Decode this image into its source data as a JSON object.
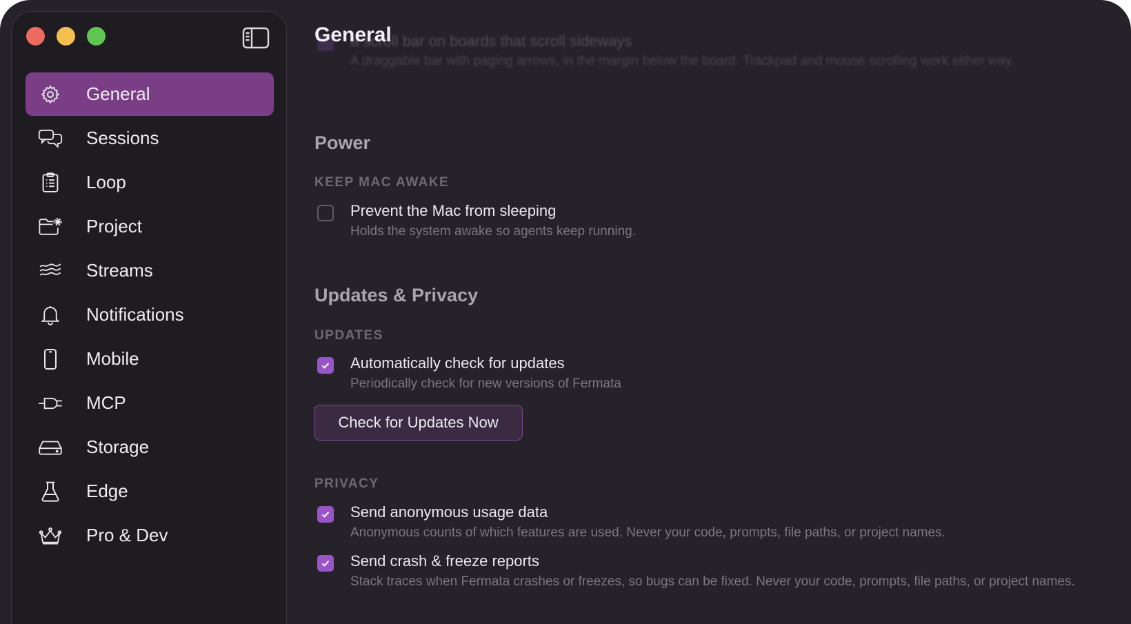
{
  "window": {
    "traffic_lights": [
      "#ed6a5e",
      "#f4bf4f",
      "#61c554"
    ],
    "accent": "#7a3e86"
  },
  "sidebar": {
    "toggle_icon": "sidebar-toggle-icon",
    "items": [
      {
        "label": "General",
        "icon": "gear-icon",
        "active": true
      },
      {
        "label": "Sessions",
        "icon": "chat-bubbles-icon"
      },
      {
        "label": "Loop",
        "icon": "clipboard-list-icon"
      },
      {
        "label": "Project",
        "icon": "folder-gear-icon"
      },
      {
        "label": "Streams",
        "icon": "waves-icon"
      },
      {
        "label": "Notifications",
        "icon": "bell-icon"
      },
      {
        "label": "Mobile",
        "icon": "phone-icon"
      },
      {
        "label": "MCP",
        "icon": "plug-icon"
      },
      {
        "label": "Storage",
        "icon": "drive-icon"
      },
      {
        "label": "Edge",
        "icon": "flask-icon"
      },
      {
        "label": "Pro & Dev",
        "icon": "crown-icon"
      }
    ]
  },
  "main": {
    "title": "General",
    "scrolled_option": {
      "title": "a scroll bar on boards that scroll sideways",
      "desc": "A draggable bar with paging arrows, in the margin below the board. Trackpad and mouse scrolling work either way."
    },
    "power": {
      "title": "Power",
      "group": "KEEP MAC AWAKE",
      "option": {
        "title": "Prevent the Mac from sleeping",
        "desc": "Holds the system awake so agents keep running.",
        "checked": false
      }
    },
    "updates_privacy": {
      "title": "Updates & Privacy",
      "updates_group": "UPDATES",
      "auto_update": {
        "title": "Automatically check for updates",
        "desc": "Periodically check for new versions of Fermata",
        "checked": true
      },
      "check_button": "Check for Updates Now",
      "privacy_group": "PRIVACY",
      "usage": {
        "title": "Send anonymous usage data",
        "desc": "Anonymous counts of which features are used. Never your code, prompts, file paths, or project names.",
        "checked": true
      },
      "crash": {
        "title": "Send crash & freeze reports",
        "desc": "Stack traces when Fermata crashes or freezes, so bugs can be fixed. Never your code, prompts, file paths, or project names.",
        "checked": true
      }
    }
  }
}
